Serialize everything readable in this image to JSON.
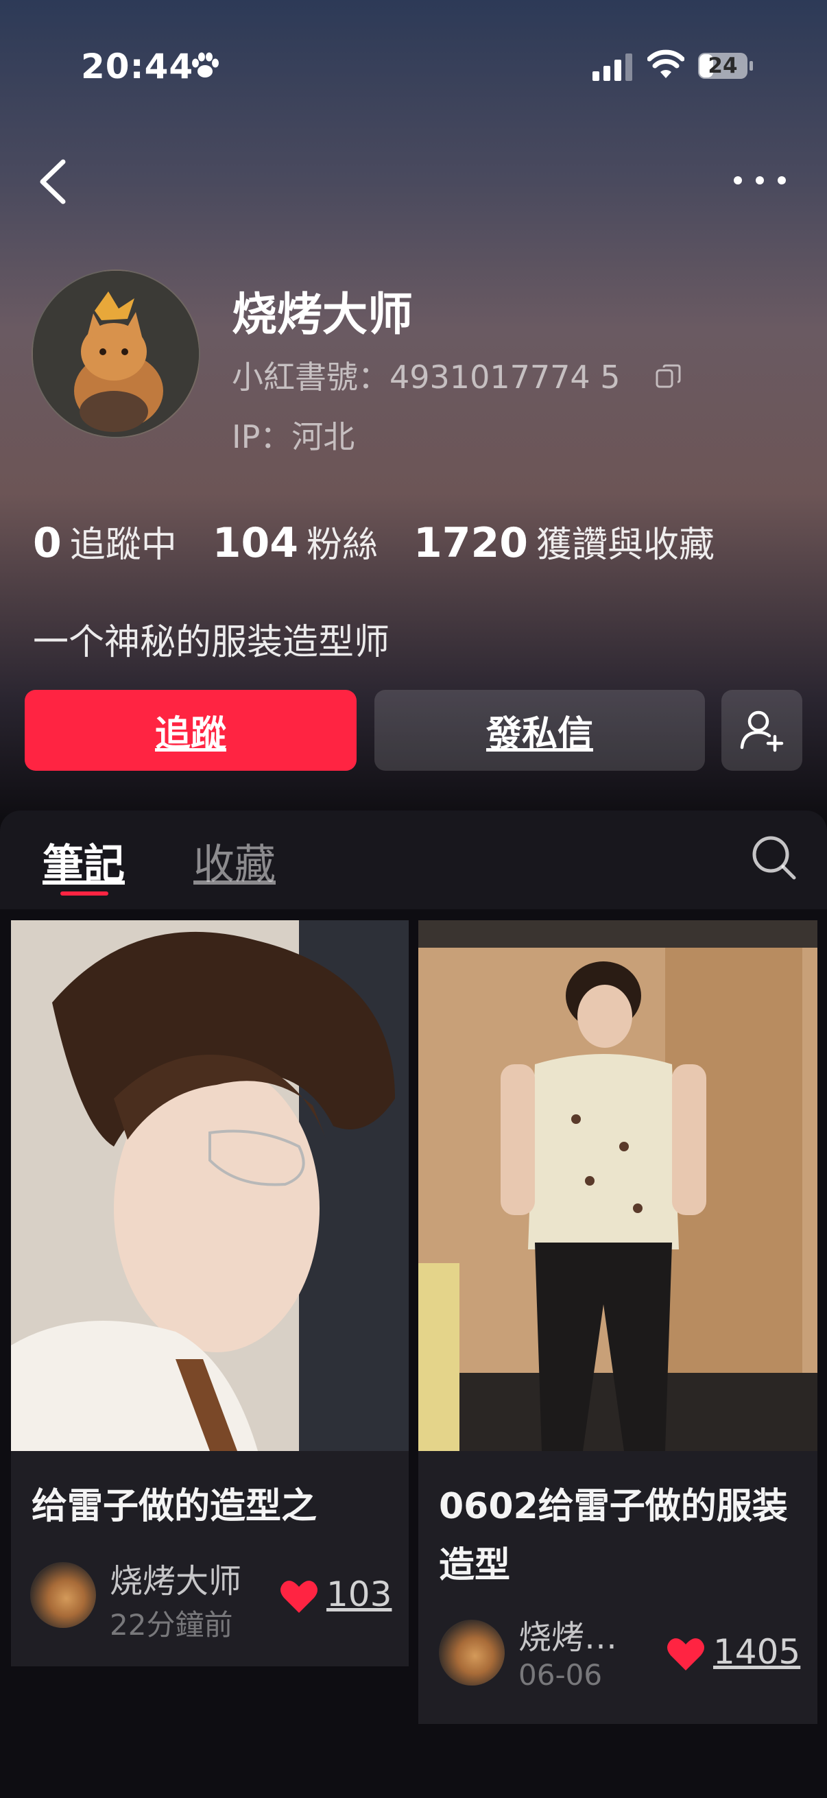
{
  "status_bar": {
    "time": "20:44",
    "battery": "24"
  },
  "nav": {
    "back_icon": "chevron-left-icon",
    "more_icon": "more-dots-icon"
  },
  "profile": {
    "name": "烧烤大师",
    "id_text": "小紅書號：4931017774 5",
    "ip_text": "IP：河北",
    "bio": "一个神秘的服装造型师",
    "stats": [
      {
        "value": "0",
        "label": "追蹤中"
      },
      {
        "value": "104",
        "label": "粉絲"
      },
      {
        "value": "1720",
        "label": "獲讚與收藏"
      }
    ],
    "follow_label": "追蹤",
    "message_label": "發私信",
    "accent_color": "#ff2442"
  },
  "tabs": {
    "notes": "筆記",
    "saved": "收藏"
  },
  "notes": [
    {
      "title": "给雷子做的造型之",
      "author": "烧烤大师",
      "time": "22分鐘前",
      "likes": "103"
    },
    {
      "title": "0602给雷子做的服装造型",
      "author": "烧烤…",
      "time": "06-06",
      "likes": "1405"
    }
  ]
}
